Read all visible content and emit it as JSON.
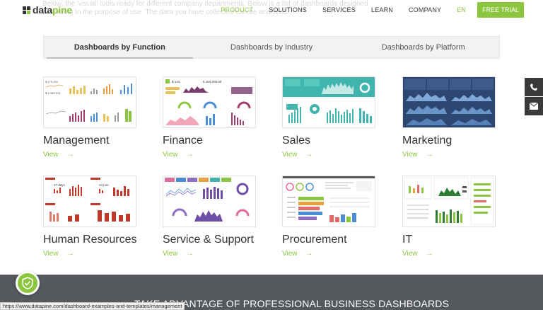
{
  "header": {
    "logo_dark": "data",
    "logo_light": "pine",
    "faded_line_1": "Below, the 'visual' tools ready for different company departments. Below is a list of dashboards designed",
    "faded_line_2": "according to the purpose of use. The data you have collected can be analyzed.",
    "nav": [
      "PRODUCT",
      "SOLUTIONS",
      "SERVICES",
      "LEARN",
      "COMPANY"
    ],
    "lang": "EN",
    "cta": "FREE TRIAL"
  },
  "tabs": [
    "Dashboards by Function",
    "Dashboards by Industry",
    "Dashboards by Platform"
  ],
  "cards": [
    {
      "title": "Management",
      "link": "View",
      "arrow": "→"
    },
    {
      "title": "Finance",
      "link": "View",
      "arrow": "→"
    },
    {
      "title": "Sales",
      "link": "View",
      "arrow": "→"
    },
    {
      "title": "Marketing",
      "link": "View",
      "arrow": "→"
    },
    {
      "title": "Human Resources",
      "link": "View",
      "arrow": "→"
    },
    {
      "title": "Service & Support",
      "link": "View",
      "arrow": "→"
    },
    {
      "title": "Procurement",
      "link": "View",
      "arrow": "→"
    },
    {
      "title": "IT",
      "link": "View",
      "arrow": "→"
    }
  ],
  "thumb_text": {
    "management": [
      "$ 479,159",
      "$ 1,063,578"
    ],
    "finance": [
      "$ 144",
      "€ 163,008.00"
    ],
    "marketing": [
      "$584,822",
      "$1,280,000",
      "$35,321",
      "$5,102"
    ],
    "hr": [
      "17 days",
      "13 min"
    ]
  },
  "footer": {
    "title": "TAKE ADVANTAGE OF PROFESSIONAL BUSINESS DASHBOARDS"
  },
  "status_url": "https://www.datapine.com/dashboard-examples-and-templates/management",
  "colors": {
    "brand_green": "#8cc63f",
    "footer_band": "#55595e",
    "side_button": "#3a3a3a"
  },
  "icons": {
    "phone": "phone-icon",
    "mail": "mail-icon",
    "shield": "shield-check-icon"
  }
}
